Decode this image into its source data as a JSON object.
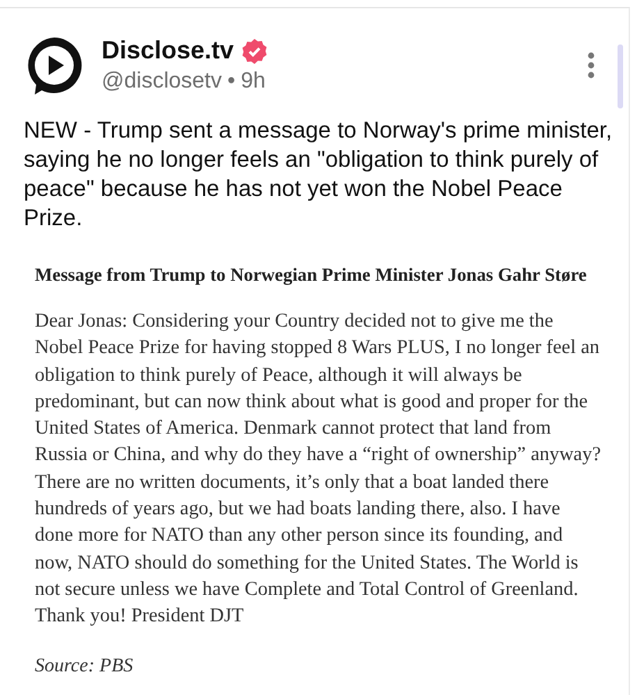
{
  "post": {
    "author": "Disclose.tv",
    "verified": true,
    "handle": "@disclosetv",
    "separator": "•",
    "time": "9h",
    "text": "NEW - Trump sent a message to Norway's prime minister, saying he no longer feels an \"obligation to think purely of peace\" because he has not yet won the Nobel Peace Prize.",
    "attachment": {
      "heading": "Message from Trump to Norwegian Prime Minister Jonas Gahr Støre",
      "body": "Dear Jonas: Considering your Country decided not to give me the Nobel Peace Prize for having stopped 8 Wars PLUS, I no longer feel an obligation to think purely of Peace, although it will always be predominant, but can now think about what is good and proper for the United States of America. Denmark cannot protect that land from Russia or China, and why do they have a “right of ownership” anyway? There are no written documents, it’s only that a boat landed there hundreds of years ago, but we had boats landing there, also. I have done more for NATO than any other person since its founding, and now, NATO should do something for the United States. The World is not secure unless we have Complete and Total Control of Greenland. Thank you! President DJT",
      "source": "Source: PBS"
    }
  }
}
